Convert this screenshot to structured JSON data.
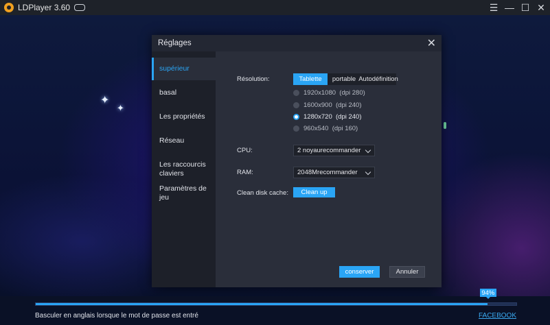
{
  "titlebar": {
    "app_title": "LDPlayer 3.60",
    "icons": [
      "ldplayer-logo-icon",
      "gamepad-icon",
      "menu-icon",
      "minimize-icon",
      "maximize-icon",
      "close-icon"
    ],
    "menu_glyph": "☰",
    "min_glyph": "—",
    "max_glyph": "☐",
    "close_glyph": "✕"
  },
  "dialog": {
    "title": "Réglages",
    "close_glyph": "✕",
    "sidebar": {
      "items": [
        {
          "label": "supérieur",
          "active": true
        },
        {
          "label": "basal"
        },
        {
          "label": "Les propriétés"
        },
        {
          "label": "Réseau"
        },
        {
          "label": "Les raccourcis claviers"
        },
        {
          "label": "Paramètres de jeu"
        }
      ]
    },
    "resolution": {
      "label": "Résolution:",
      "tabs": [
        "Tablette",
        "portable",
        "Autodéfinition"
      ],
      "selected_tab": "Tablette",
      "options": [
        {
          "label": "1920x1080  (dpi 280)",
          "selected": false
        },
        {
          "label": "1600x900  (dpi 240)",
          "selected": false
        },
        {
          "label": "1280x720  (dpi 240)",
          "selected": true
        },
        {
          "label": "960x540  (dpi 160)",
          "selected": false
        }
      ]
    },
    "cpu": {
      "label": "CPU:",
      "value": "2 noyaurecommander"
    },
    "ram": {
      "label": "RAM:",
      "value": "2048Mrecommander"
    },
    "cache": {
      "label": "Clean disk cache:",
      "button": "Clean up"
    },
    "buttons": {
      "save": "conserver",
      "cancel": "Annuler"
    }
  },
  "bottom": {
    "progress_percent": 94,
    "progress_label": "94%",
    "hint": "Basculer en anglais lorsque le mot de passe est entré",
    "link": "FACEBOOK"
  },
  "colors": {
    "accent": "#2aa5f5",
    "dialog_bg": "#232733",
    "panel_bg": "#2a2e3a"
  }
}
